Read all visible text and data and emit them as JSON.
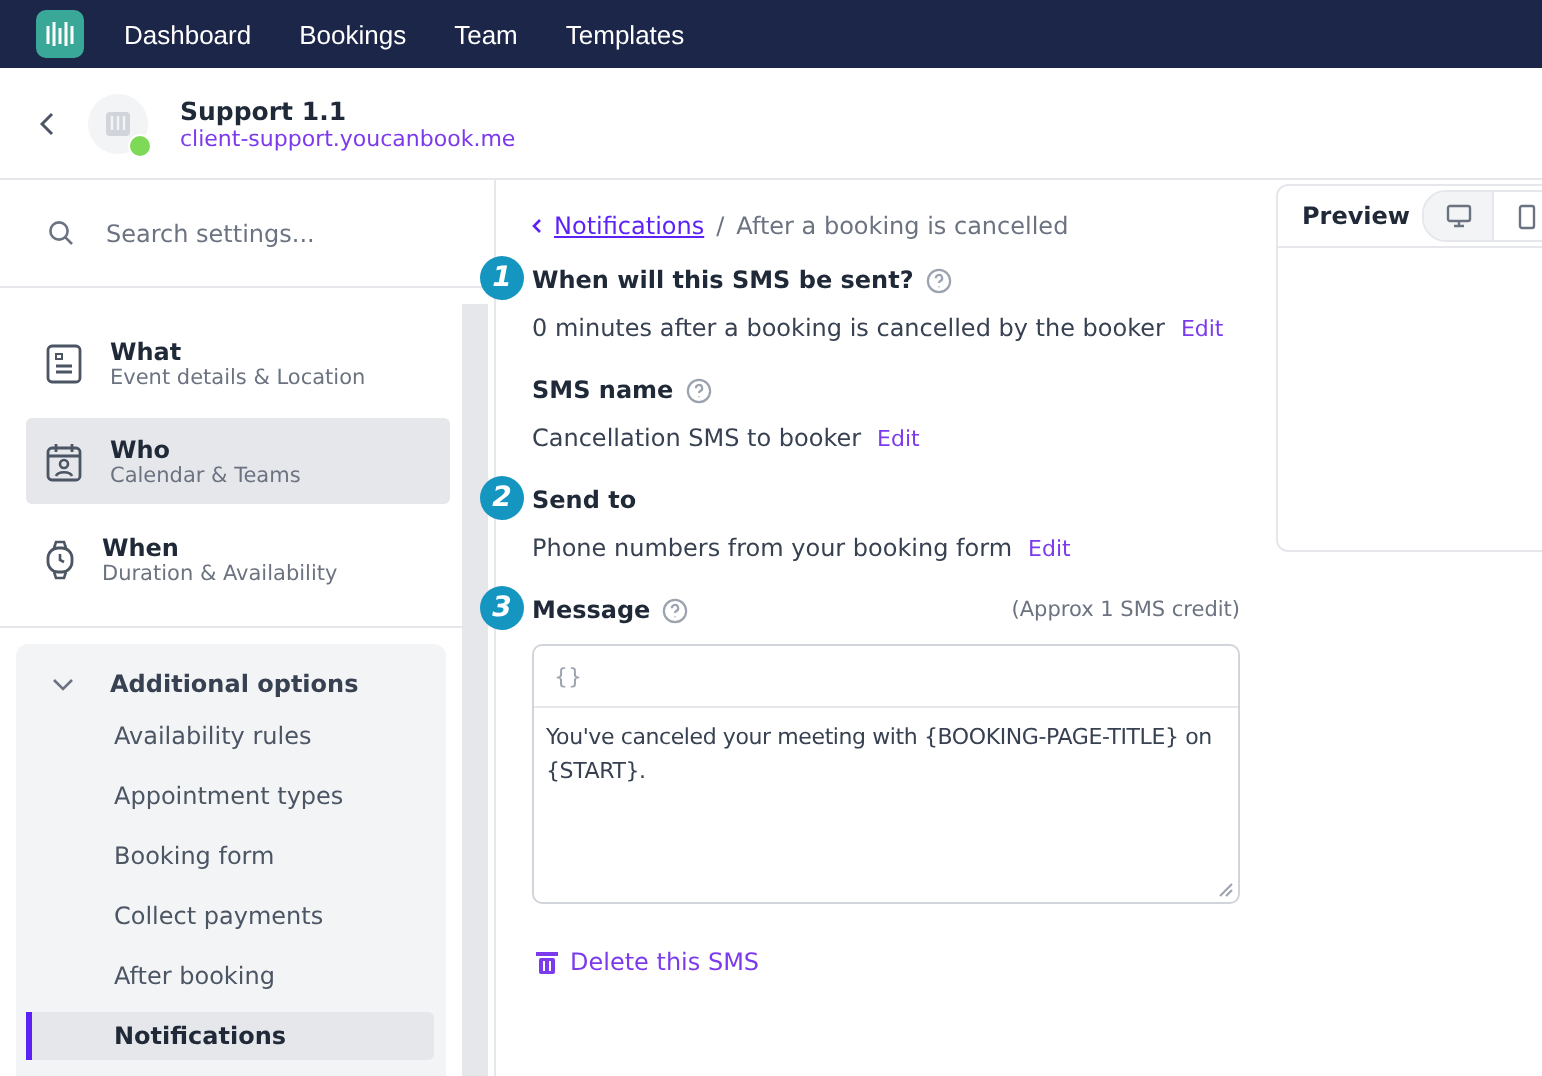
{
  "topnav": {
    "items": [
      "Dashboard",
      "Bookings",
      "Team",
      "Templates"
    ]
  },
  "header": {
    "title": "Support 1.1",
    "url": "client-support.youcanbook.me",
    "online": true
  },
  "sidebar": {
    "search": {
      "placeholder": "Search settings..."
    },
    "sections": [
      {
        "kind": "what",
        "title": "What",
        "subtitle": "Event details & Location",
        "selected": false
      },
      {
        "kind": "who",
        "title": "Who",
        "subtitle": "Calendar & Teams",
        "selected": true
      },
      {
        "kind": "when",
        "title": "When",
        "subtitle": "Duration & Availability",
        "selected": false
      }
    ],
    "additional": {
      "title": "Additional options",
      "expanded": true,
      "items": [
        {
          "label": "Availability rules",
          "selected": false
        },
        {
          "label": "Appointment types",
          "selected": false
        },
        {
          "label": "Booking form",
          "selected": false
        },
        {
          "label": "Collect payments",
          "selected": false
        },
        {
          "label": "After booking",
          "selected": false
        },
        {
          "label": "Notifications",
          "selected": true
        }
      ]
    }
  },
  "breadcrumb": {
    "link": "Notifications",
    "separator": "/",
    "current": "After a booking is cancelled"
  },
  "fields": [
    {
      "step": "1",
      "label": "When will this SMS be sent?",
      "help": true,
      "value": "0 minutes after a booking is cancelled by the booker",
      "action": "Edit"
    },
    {
      "label": "SMS name",
      "help": true,
      "value": "Cancellation SMS to booker",
      "action": "Edit"
    },
    {
      "step": "2",
      "label": "Send to",
      "help": false,
      "value": "Phone numbers from your booking form",
      "action": "Edit"
    }
  ],
  "message": {
    "step": "3",
    "label": "Message",
    "note": "(Approx 1 SMS credit)",
    "toolbar": "{}",
    "value": "You've canceled your meeting with {BOOKING-PAGE-TITLE} on {START}."
  },
  "delete": "Delete this SMS",
  "preview": {
    "title": "Preview",
    "devices": [
      {
        "kind": "desktop",
        "selected": true
      },
      {
        "kind": "mobile",
        "selected": false
      }
    ]
  }
}
